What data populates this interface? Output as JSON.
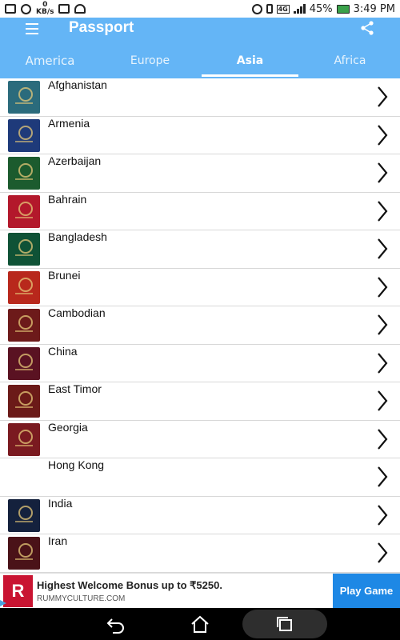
{
  "status_bar": {
    "speed_value": "0",
    "speed_unit": "KB/s",
    "network": "4G",
    "battery": "45%",
    "time": "3:49 PM"
  },
  "app": {
    "title": "Passport",
    "icons": {
      "menu": "hamburger-menu-icon",
      "share": "share-icon"
    }
  },
  "tabs": [
    {
      "label": "America",
      "active": false
    },
    {
      "label": "Europe",
      "active": false
    },
    {
      "label": "Asia",
      "active": true
    },
    {
      "label": "Africa",
      "active": false
    }
  ],
  "countries": [
    {
      "name": "Afghanistan",
      "color": "#2b6b7c"
    },
    {
      "name": "Armenia",
      "color": "#1e3a7a"
    },
    {
      "name": "Azerbaijan",
      "color": "#1c5b2e"
    },
    {
      "name": "Bahrain",
      "color": "#b3182b"
    },
    {
      "name": "Bangladesh",
      "color": "#0f5236"
    },
    {
      "name": "Brunei",
      "color": "#b8281c"
    },
    {
      "name": "Cambodian",
      "color": "#6d1a1a"
    },
    {
      "name": "China",
      "color": "#5a1222"
    },
    {
      "name": "East Timor",
      "color": "#6b1a18"
    },
    {
      "name": "Georgia",
      "color": "#7a1a20"
    },
    {
      "name": "Hong Kong",
      "color": "#ffffff"
    },
    {
      "name": "India",
      "color": "#14213d"
    },
    {
      "name": "Iran",
      "color": "#4a1218"
    }
  ],
  "ad": {
    "logo": "R",
    "headline": "Highest Welcome Bonus up to ₹5250.",
    "url": "RUMMYCULTURE.COM",
    "cta": "Play Game"
  },
  "colors": {
    "app_bar": "#64b5f6",
    "ad_button": "#1e88e5",
    "nav_bar": "#000000"
  }
}
